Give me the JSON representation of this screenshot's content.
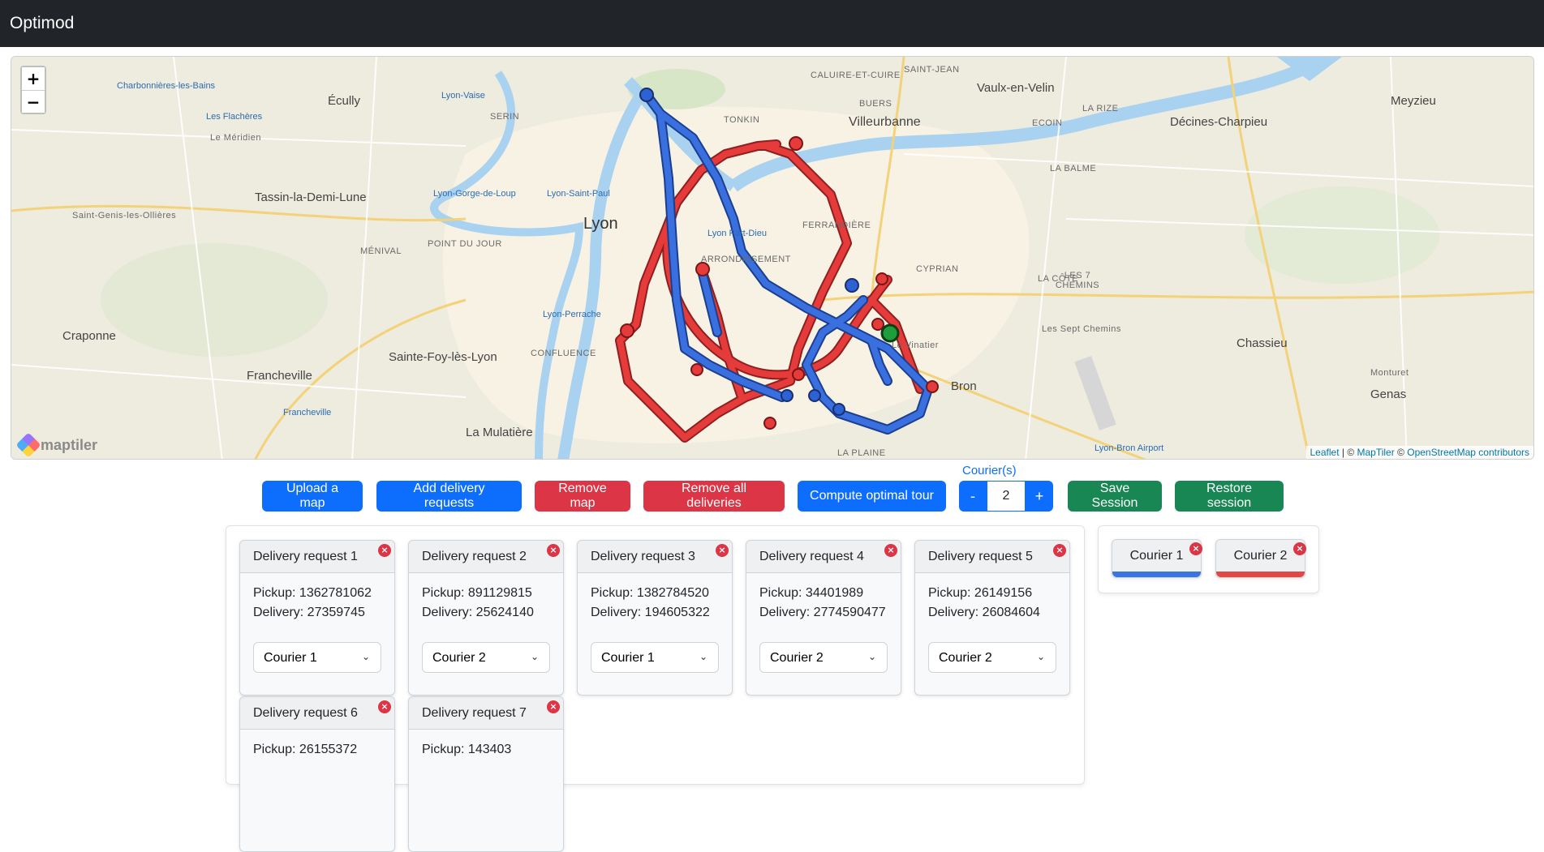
{
  "app": {
    "title": "Optimod"
  },
  "map": {
    "zoom_in": "+",
    "zoom_out": "−",
    "attribution": {
      "leaflet": "Leaflet",
      "sep1": " | © ",
      "maptiler": "MapTiler",
      "sep2": " © ",
      "osm": "OpenStreetMap contributors"
    },
    "logo": "maptiler",
    "labels": [
      "Charbonnières-les-Bains",
      "Lyon-Vaise",
      "Écully",
      "Les Flachères",
      "Le Méridien",
      "Tassin-la-Demi-Lune",
      "Saint-Genis-les-Ollières",
      "Lyon-Gorge-de-Loup",
      "Lyon-Saint-Paul",
      "Lyon",
      "POINT DU JOUR",
      "MÉNIVAL",
      "Craponne",
      "Francheville",
      "Sainte-Foy-lès-Lyon",
      "Lyon-Perrache",
      "CONFLUENCE",
      "La Mulatière",
      "Francheville",
      "CALUIRE-ET-CUIRE",
      "SERIN",
      "TONKIN",
      "Villeurbanne",
      "BUERS",
      "SAINT-JEAN",
      "Vaulx-en-Velin",
      "LA RIZE",
      "ECOIN",
      "Décines-Charpieu",
      "Meyzieu",
      "LA BALME",
      "FERRANDIÈRE",
      "Lyon Part-Dieu",
      "ARRONDISSEMENT",
      "CYPRIAN",
      "LA CÔTE",
      "LES 7 CHEMINS",
      "Les Sept Chemins",
      "Chassieu",
      "Bron",
      "Genas",
      "Monturet",
      "LA PLAINE",
      "Lyon-Bron Airport",
      "Le Vinatier"
    ],
    "couriers": [
      {
        "name": "Courier 1",
        "color": "#2c62d6"
      },
      {
        "name": "Courier 2",
        "color": "#d93a3a"
      }
    ],
    "warehouse_color": "#1f9d3a"
  },
  "toolbar": {
    "upload_map": "Upload a map",
    "add_requests": "Add delivery requests",
    "remove_map": "Remove map",
    "remove_deliveries": "Remove all deliveries",
    "compute_tour": "Compute optimal tour",
    "courier_count_label": "Courier(s)",
    "decrement": "-",
    "courier_count": "2",
    "increment": "+",
    "save_session": "Save Session",
    "restore_session": "Restore session"
  },
  "requests": [
    {
      "title": "Delivery request 1",
      "pickup": "Pickup: 1362781062",
      "delivery": "Delivery: 27359745",
      "courier": "Courier 1"
    },
    {
      "title": "Delivery request 2",
      "pickup": "Pickup: 891129815",
      "delivery": "Delivery: 25624140",
      "courier": "Courier 2"
    },
    {
      "title": "Delivery request 3",
      "pickup": "Pickup: 1382784520",
      "delivery": "Delivery: 194605322",
      "courier": "Courier 1"
    },
    {
      "title": "Delivery request 4",
      "pickup": "Pickup: 34401989",
      "delivery": "Delivery: 2774590477",
      "courier": "Courier 2"
    },
    {
      "title": "Delivery request 5",
      "pickup": "Pickup: 26149156",
      "delivery": "Delivery: 26084604",
      "courier": "Courier 2"
    },
    {
      "title": "Delivery request 6",
      "pickup": "Pickup: 26155372",
      "delivery": "",
      "courier": ""
    },
    {
      "title": "Delivery request 7",
      "pickup": "Pickup: 143403",
      "delivery": "",
      "courier": ""
    }
  ],
  "courier_options": [
    "Courier 1",
    "Courier 2"
  ],
  "courier_cards": [
    {
      "name": "Courier 1",
      "color": "#3b73e0"
    },
    {
      "name": "Courier 2",
      "color": "#e04848"
    }
  ],
  "close_glyph": "×",
  "chevron_glyph": "⌄"
}
